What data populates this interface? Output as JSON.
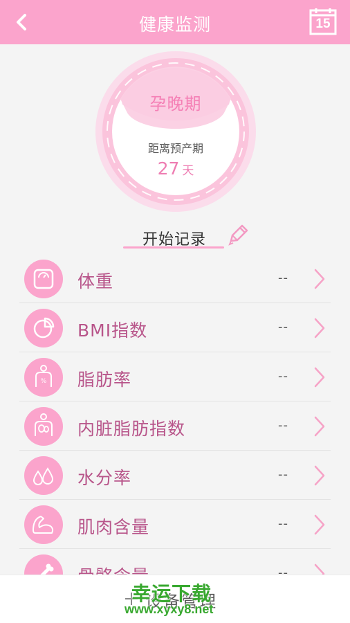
{
  "header": {
    "title": "健康监测",
    "calendar_day": "15",
    "back_icon": "chevron-left-icon",
    "calendar_icon": "calendar-icon"
  },
  "pregnancy": {
    "stage": "孕晚期",
    "due_label": "距离预产期",
    "days": "27",
    "days_unit": "天"
  },
  "record": {
    "label": "开始记录",
    "icon": "pencil-icon"
  },
  "metrics": [
    {
      "label": "体重",
      "value": "--",
      "icon": "scale-icon"
    },
    {
      "label": "BMI指数",
      "value": "--",
      "icon": "pie-chart-icon"
    },
    {
      "label": "脂肪率",
      "value": "--",
      "icon": "body-fat-icon"
    },
    {
      "label": "内脏脂肪指数",
      "value": "--",
      "icon": "visceral-fat-icon"
    },
    {
      "label": "水分率",
      "value": "--",
      "icon": "water-drop-icon"
    },
    {
      "label": "肌肉含量",
      "value": "--",
      "icon": "muscle-arm-icon"
    },
    {
      "label": "骨骼含量",
      "value": "--",
      "icon": "bone-icon"
    }
  ],
  "bottom_bar": {
    "label": "设备管理",
    "icon": "plus-icon"
  },
  "watermark": {
    "title": "幸运下载",
    "url": "www.xyxy8.net"
  },
  "colors": {
    "accent": "#fba4cc",
    "label_pink": "#b8558a",
    "background": "#f4f4f4",
    "watermark_green": "#38a82f"
  }
}
